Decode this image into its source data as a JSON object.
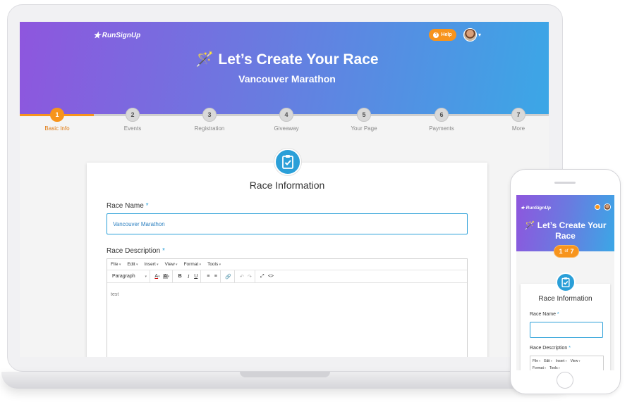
{
  "app": {
    "brand": "RunSignUp",
    "help_label": "Help"
  },
  "hero": {
    "title": "Let’s Create Your Race",
    "subtitle": "Vancouver Marathon"
  },
  "stepper": {
    "steps": [
      {
        "number": "1",
        "label": "Basic Info"
      },
      {
        "number": "2",
        "label": "Events"
      },
      {
        "number": "3",
        "label": "Registration"
      },
      {
        "number": "4",
        "label": "Giveaway"
      },
      {
        "number": "5",
        "label": "Your Page"
      },
      {
        "number": "6",
        "label": "Payments"
      },
      {
        "number": "7",
        "label": "More"
      }
    ],
    "active_step": 1
  },
  "form": {
    "title": "Race Information",
    "race_name_label": "Race Name",
    "race_name_value": "Vancouver Marathon",
    "race_description_label": "Race Description",
    "required_marker": "*",
    "editor": {
      "menu": [
        "File",
        "Edit",
        "Insert",
        "View",
        "Format",
        "Tools"
      ],
      "block_format": "Paragraph",
      "content": "test"
    }
  },
  "mobile": {
    "brand": "RunSignUp",
    "title": "Let’s Create Your Race",
    "progress_current": "1",
    "progress_of": "of",
    "progress_total": "7",
    "form_title": "Race Information",
    "race_name_label": "Race Name",
    "race_description_label": "Race Description",
    "required_marker": "*",
    "editor_menu": [
      "File",
      "Edit",
      "Insert",
      "View",
      "Format",
      "Tools"
    ]
  },
  "colors": {
    "accent": "#2a9fd8",
    "orange": "#f7941d",
    "gradient_start": "#8e56de",
    "gradient_end": "#3ba7e6"
  }
}
